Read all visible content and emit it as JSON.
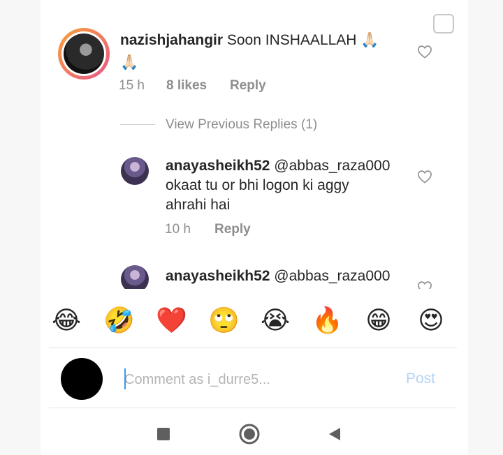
{
  "comments": {
    "main": {
      "username": "nazishjahangir",
      "text_line1": "Soon INSHAALLAH 🙏🏻",
      "text_line2": "🙏🏻",
      "time": "15 h",
      "likes": "8 likes",
      "reply_label": "Reply"
    },
    "view_previous": "View Previous Replies (1)",
    "reply1": {
      "username": "anayasheikh52",
      "mention": "@abbas_raza000",
      "text_line1": "okaat tu or bhi logon ki aggy",
      "text_line2": "ahrahi hai",
      "time": "10 h",
      "reply_label": "Reply"
    },
    "reply2": {
      "username": "anayasheikh52",
      "mention": "@abbas_raza000"
    }
  },
  "emoji_bar": [
    "😂",
    "🤣",
    "❤️",
    "🙄",
    "😭",
    "🔥",
    "😁",
    "😍"
  ],
  "composer": {
    "placeholder": "Comment as i_durre5...",
    "post_label": "Post"
  },
  "colors": {
    "text": "#262626",
    "meta": "#8e8e8e",
    "post_disabled": "#b3d3f5",
    "heart_red": "#ed1c24"
  },
  "icons": {
    "like": "heart-outline-icon",
    "nav_recents": "square-icon",
    "nav_home": "circle-icon",
    "nav_back": "triangle-back-icon"
  }
}
